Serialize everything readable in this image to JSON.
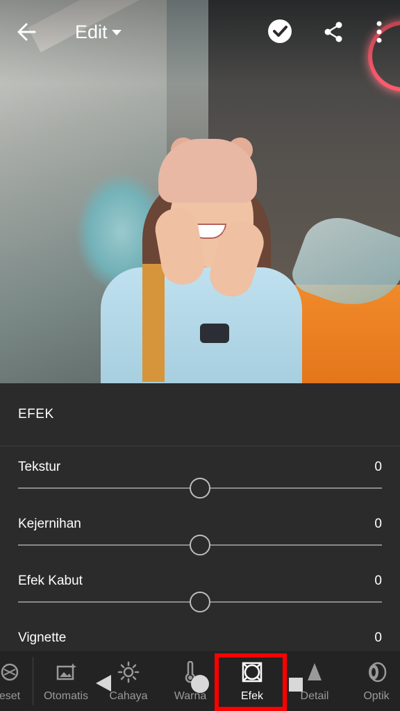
{
  "header": {
    "title": "Edit",
    "icons": [
      "back-arrow-icon",
      "dropdown-caret-icon",
      "confirm-check-icon",
      "share-icon",
      "more-vertical-icon"
    ]
  },
  "panel": {
    "title": "EFEK",
    "sliders": [
      {
        "label": "Tekstur",
        "value": "0",
        "position": 0.5
      },
      {
        "label": "Kejernihan",
        "value": "0",
        "position": 0.5
      },
      {
        "label": "Efek Kabut",
        "value": "0",
        "position": 0.5
      },
      {
        "label": "Vignette",
        "value": "0"
      }
    ]
  },
  "tabs": [
    {
      "label": "eset",
      "icon": "preset-icon"
    },
    {
      "label": "Otomatis",
      "icon": "auto-icon"
    },
    {
      "label": "Cahaya",
      "icon": "sun-icon"
    },
    {
      "label": "Warna",
      "icon": "thermometer-icon"
    },
    {
      "label": "Efek",
      "icon": "effects-icon",
      "active": true
    },
    {
      "label": "Detail",
      "icon": "triangle-detail-icon"
    },
    {
      "label": "Optik",
      "icon": "lens-icon"
    }
  ],
  "colors": {
    "highlight": "#ff0000",
    "panel_bg": "#2b2b2b",
    "tabbar_bg": "#232323"
  }
}
